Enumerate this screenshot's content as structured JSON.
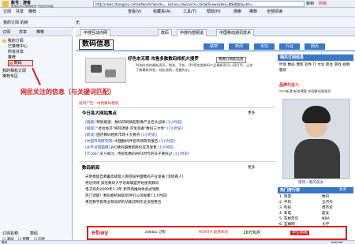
{
  "header": {
    "account": "账号：游客",
    "subtext": "登录后可以使用更多个性化的功能",
    "toolbar_label": "无",
    "address": "http://news.zhongsou.com/wfwords?words=...&class=0&source=c&tabSnews&key=数码相机&utm=...",
    "shop_label": "购物",
    "go_label": "转到"
  },
  "nav": {
    "items": [
      "订阅",
      "共享",
      "推荐",
      "查看(V)",
      "收藏夹(A)",
      "工具(T)",
      "帮助(H)",
      "搜索",
      "推荐",
      "全部阅读"
    ],
    "section_title": "数码信息",
    "section_title2": "我的订阅"
  },
  "sidebar": {
    "title": "我的订阅 的树",
    "toolbar": [
      "订阅",
      "共享",
      "推荐"
    ],
    "tree": [
      "我的订阅",
      "已推荐中心",
      "所有共享",
      "推荐",
      "数码",
      "我的相机订阅",
      "推荐专区"
    ],
    "selected_label": "数码",
    "bottom_label": "订阅名称:",
    "bottom_value": "数码",
    "checks": [
      "滚动",
      "提醒",
      "同步"
    ]
  },
  "tabs": {
    "items": [
      "中搜互动内网",
      "数码",
      "中搜内部频道",
      "中国移动通讯技术"
    ]
  },
  "banner": {
    "site_title": "数码信息",
    "nav_tabs": [
      "贴吧",
      "新闻",
      "论坛",
      "行业",
      "网页"
    ],
    "product_title": "好色本无罪 市售多款数码相机大搜罗",
    "product_button": "我要订阅此信息",
    "product_desc": "科技时尚的最新资讯。相机、手机、DV等各类数码产品最新资讯一网打尽，让你了解最新消息，轻松选购，把握先机。...",
    "annotation": "网民关注的信息（与关键词匹配）",
    "ad_label": "投资广告：绿色数码相机"
  },
  "today": {
    "title": "今日各大网站焦点",
    "more": "更多",
    "items": [
      {
        "src": "[搜狐]",
        "text": "特别报道：数码印刷挑起影像产业巨头战争",
        "time": "(1小时前)"
      },
      {
        "src": "[搜狐]",
        "text": "\"考拉经济\"将热诱降 学生装备\"数码三大件\"",
        "time": "(1小时前)"
      },
      {
        "src": "[新浪]",
        "text": "国内数码相机市场十大看点",
        "time": "(1小时前)"
      },
      {
        "src": "[中国市场研究网]",
        "text": "中国数码伴侣市场研究报告",
        "time": "(1小时前)"
      },
      {
        "src": "[太平洋电脑网]",
        "text": "JVC数码摄像机降价在苏发售",
        "time": "(1小时前)"
      },
      {
        "src": "[IT168]",
        "text": "深入探讨，传统和数码MP3时代的日子要好过",
        "time": "(1小时前)"
      }
    ]
  },
  "news": {
    "title": "数码新闻",
    "more": "更多",
    "items": [
      "天地衡固自救戴高级套入民网设中国数码产业发展 [流程看人]",
      "柯达闭闭 索尼数码大学总裁联盟开始投资数码",
      "电子商务2009年1-3年 新市场推动体验式销售",
      "热门话题！数码相机将如何评价公司规模 [1小时前]",
      "惠普数字影像业移动新的功能印制作业流程整合"
    ]
  },
  "right": {
    "related_title": "相关订阅信息",
    "related_links": [
      "时尚",
      "数码",
      "博客",
      "软件",
      "IT",
      "文化",
      "民生",
      "游戏",
      "视频",
      "服装"
    ],
    "person_title": "品牌代言人",
    "person_text": "中兴新通 新浪博客 中国数码管理员",
    "person_caption": "值得一看的美女",
    "rank_title": "热门排行榜",
    "rank_more": "更多",
    "ranks": [
      {
        "num": "1.",
        "a": "旅游",
        "b": "数码"
      },
      {
        "num": "2.",
        "a": "手机",
        "b": "五月天"
      },
      {
        "num": "3.",
        "a": "科技",
        "b": "周杰伦"
      },
      {
        "num": "4.",
        "a": "家电",
        "b": "超女"
      },
      {
        "num": "5.",
        "a": "花样年华",
        "b": "NBA"
      },
      {
        "num": "6.",
        "a": "互联网",
        "b": "大学"
      }
    ]
  },
  "footer_ads": [
    "ebay",
    "adidas 订购",
    "18元包月",
    "学生购物",
    "WORTH 超值体验"
  ],
  "status": {
    "left": "数码",
    "right": "Internet"
  }
}
